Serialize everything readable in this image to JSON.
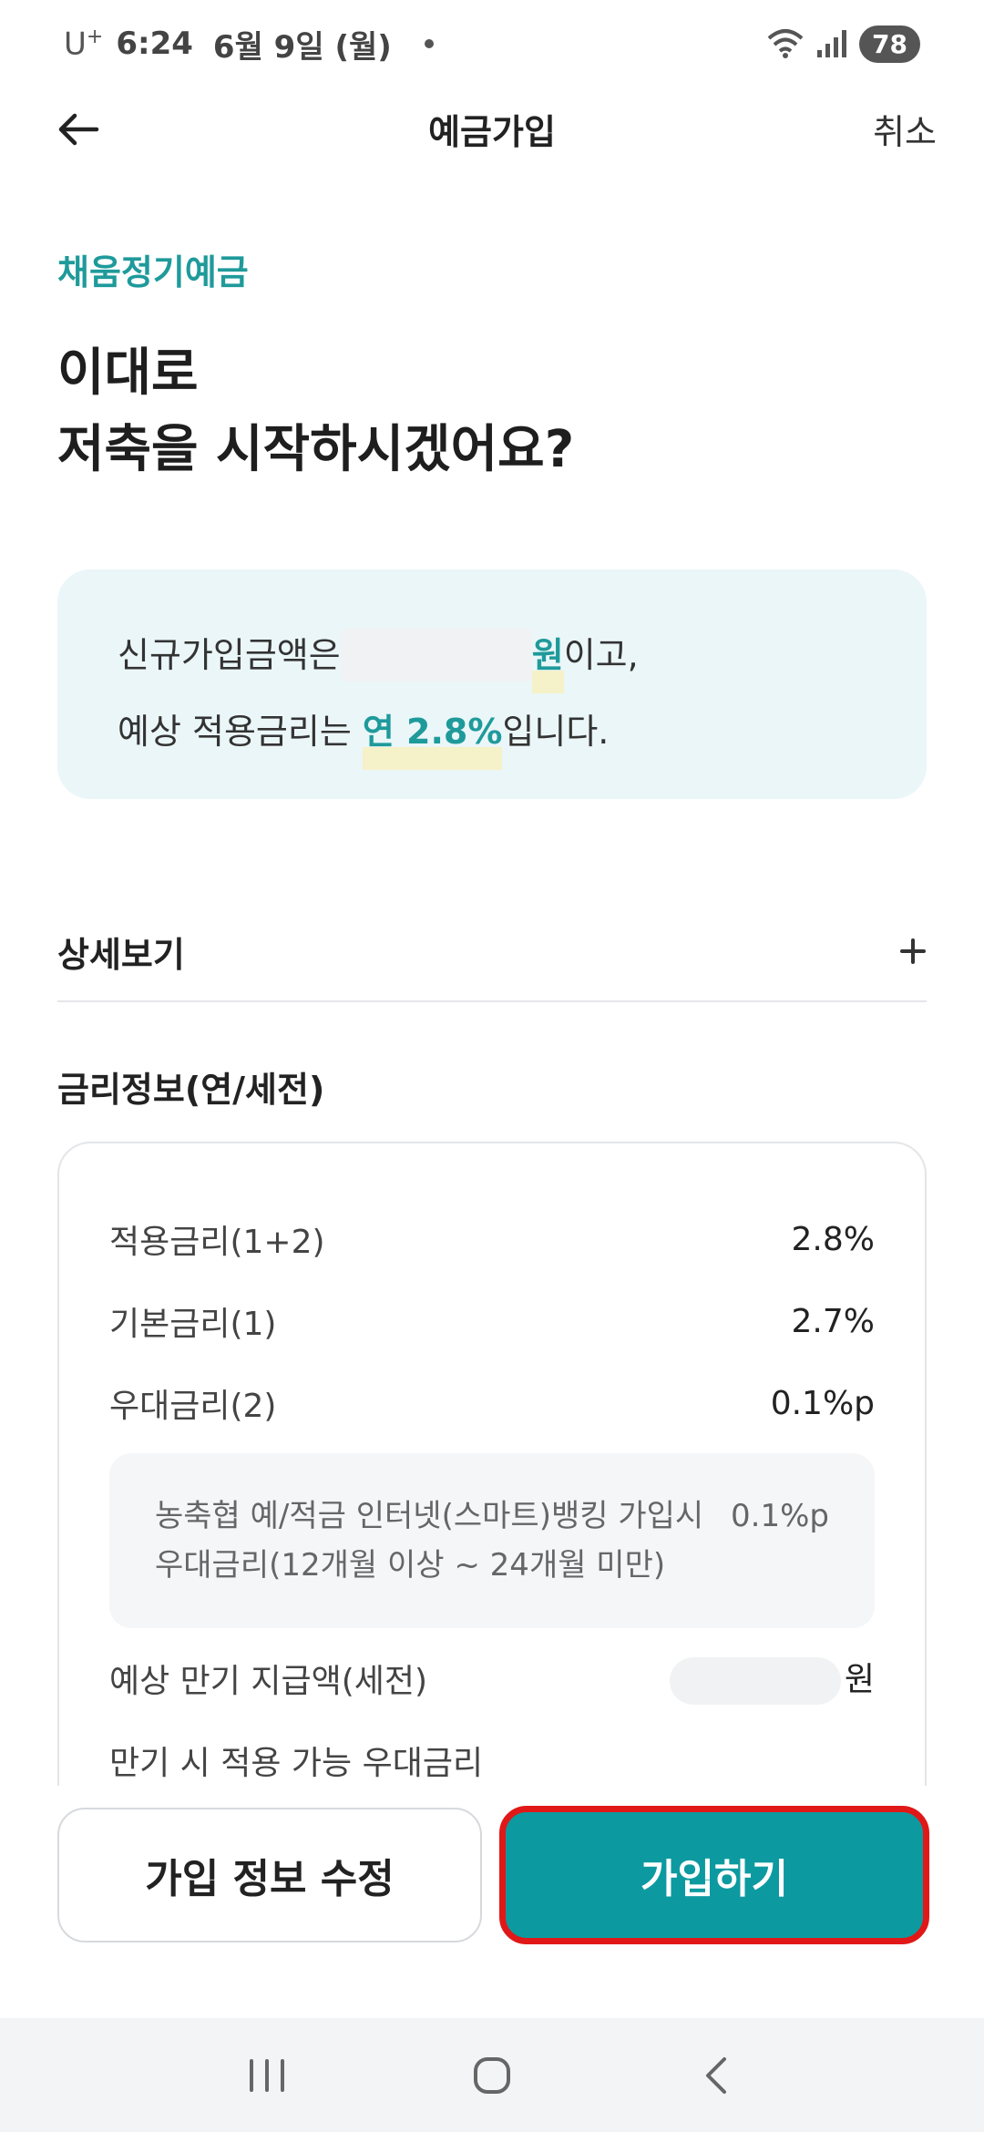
{
  "status_bar": {
    "carrier": "U",
    "carrier_sup": "+",
    "time": "6:24",
    "date": "6월 9일 (월)",
    "battery": "78"
  },
  "header": {
    "title": "예금가입",
    "cancel": "취소"
  },
  "product_name": "채움정기예금",
  "headline": {
    "line1": "이대로",
    "line2": "저축을 시작하시겠어요?"
  },
  "summary": {
    "prefix1": "신규가입금액은",
    "won": "원",
    "suffix1": "이고,",
    "prefix2": "예상 적용금리는",
    "rate": "연 2.8%",
    "suffix2": "입니다."
  },
  "detail_label": "상세보기",
  "rate_info": {
    "title": "금리정보(연/세전)",
    "rows": [
      {
        "label": "적용금리(1+2)",
        "value": "2.8%"
      },
      {
        "label": "기본금리(1)",
        "value": "2.7%"
      },
      {
        "label": "우대금리(2)",
        "value": "0.1%p"
      }
    ],
    "pref_desc_line1": "농축협 예/적금 인터넷(스마트)뱅킹 가입시",
    "pref_desc_line2": "우대금리(12개월 이상 ~ 24개월 미만)",
    "pref_value": "0.1%p",
    "maturity_label": "예상 만기 지급액(세전)",
    "maturity_unit": "원",
    "maturity_pref_label": "만기 시 적용 가능 우대금리"
  },
  "buttons": {
    "edit": "가입 정보 수정",
    "join": "가입하기"
  },
  "colors": {
    "accent": "#1f9a9b",
    "primary_button": "#0c9aa0",
    "highlight_border": "#e01818",
    "summary_bg": "#ebf6f8"
  }
}
